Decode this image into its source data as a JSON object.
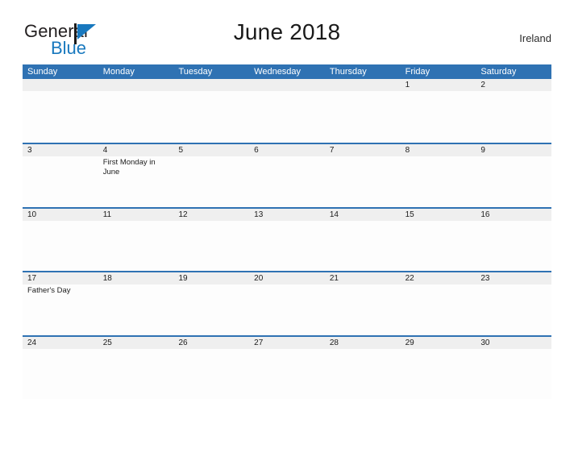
{
  "brand": {
    "name_part1": "General",
    "name_part2": "Blue",
    "flag_icon": "flag-triangle-icon",
    "color_dark": "#231f20",
    "color_blue": "#1878be"
  },
  "header": {
    "title": "June 2018",
    "country": "Ireland"
  },
  "calendar": {
    "header_color": "#2f72b3",
    "date_band_color": "#efefef",
    "weekdays": [
      "Sunday",
      "Monday",
      "Tuesday",
      "Wednesday",
      "Thursday",
      "Friday",
      "Saturday"
    ],
    "weeks": [
      {
        "days": [
          {
            "date": "",
            "event": ""
          },
          {
            "date": "",
            "event": ""
          },
          {
            "date": "",
            "event": ""
          },
          {
            "date": "",
            "event": ""
          },
          {
            "date": "",
            "event": ""
          },
          {
            "date": "1",
            "event": ""
          },
          {
            "date": "2",
            "event": ""
          }
        ]
      },
      {
        "days": [
          {
            "date": "3",
            "event": ""
          },
          {
            "date": "4",
            "event": "First Monday in June"
          },
          {
            "date": "5",
            "event": ""
          },
          {
            "date": "6",
            "event": ""
          },
          {
            "date": "7",
            "event": ""
          },
          {
            "date": "8",
            "event": ""
          },
          {
            "date": "9",
            "event": ""
          }
        ]
      },
      {
        "days": [
          {
            "date": "10",
            "event": ""
          },
          {
            "date": "11",
            "event": ""
          },
          {
            "date": "12",
            "event": ""
          },
          {
            "date": "13",
            "event": ""
          },
          {
            "date": "14",
            "event": ""
          },
          {
            "date": "15",
            "event": ""
          },
          {
            "date": "16",
            "event": ""
          }
        ]
      },
      {
        "days": [
          {
            "date": "17",
            "event": "Father's Day"
          },
          {
            "date": "18",
            "event": ""
          },
          {
            "date": "19",
            "event": ""
          },
          {
            "date": "20",
            "event": ""
          },
          {
            "date": "21",
            "event": ""
          },
          {
            "date": "22",
            "event": ""
          },
          {
            "date": "23",
            "event": ""
          }
        ]
      },
      {
        "days": [
          {
            "date": "24",
            "event": ""
          },
          {
            "date": "25",
            "event": ""
          },
          {
            "date": "26",
            "event": ""
          },
          {
            "date": "27",
            "event": ""
          },
          {
            "date": "28",
            "event": ""
          },
          {
            "date": "29",
            "event": ""
          },
          {
            "date": "30",
            "event": ""
          }
        ]
      }
    ]
  }
}
